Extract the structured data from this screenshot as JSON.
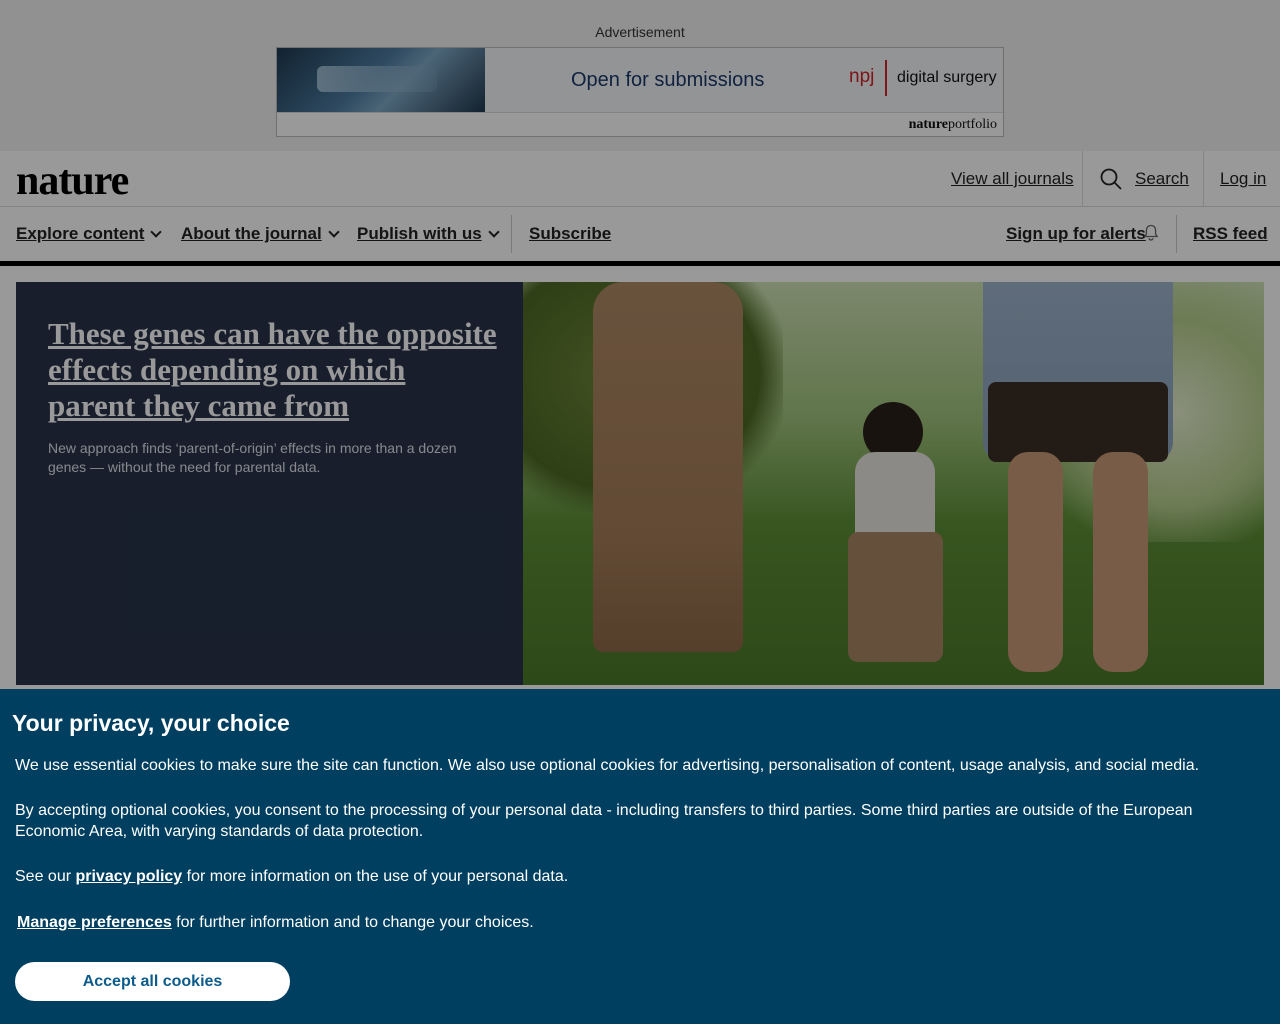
{
  "ad": {
    "label": "Advertisement",
    "tagline": "Open for submissions",
    "brand_npj": "npj",
    "brand_journal": "digital surgery",
    "footer_brand_bold": "nature",
    "footer_brand_rest": "portfolio"
  },
  "header": {
    "logo": "nature",
    "view_all_journals": "View all journals",
    "search": "Search",
    "login": "Log in"
  },
  "nav": {
    "items": [
      {
        "label": "Explore content"
      },
      {
        "label": "About the journal"
      },
      {
        "label": "Publish with us"
      },
      {
        "label": "Subscribe"
      }
    ],
    "alerts": "Sign up for alerts",
    "rss": "RSS feed"
  },
  "hero": {
    "title": "These genes can have the opposite effects depending on which parent they came from",
    "subtitle": "New approach finds ‘parent-of-origin’ effects in more than a dozen genes — without the need for parental data."
  },
  "cookie": {
    "title": "Your privacy, your choice",
    "p1": "We use essential cookies to make sure the site can function. We also use optional cookies for advertising, personalisation of content, usage analysis, and social media.",
    "p2": "By accepting optional cookies, you consent to the processing of your personal data - including transfers to third parties. Some third parties are outside of the European Economic Area, with varying standards of data protection.",
    "p3_before": "See our ",
    "p3_link": "privacy policy",
    "p3_after": " for more information on the use of your personal data.",
    "p4_link": "Manage preferences",
    "p4_after": " for further information and to change your choices.",
    "accept": "Accept all cookies"
  },
  "colors": {
    "cookie_bg": "#003f5f",
    "hero_text_bg": "#28334a",
    "accept_text": "#0b5b8b"
  }
}
